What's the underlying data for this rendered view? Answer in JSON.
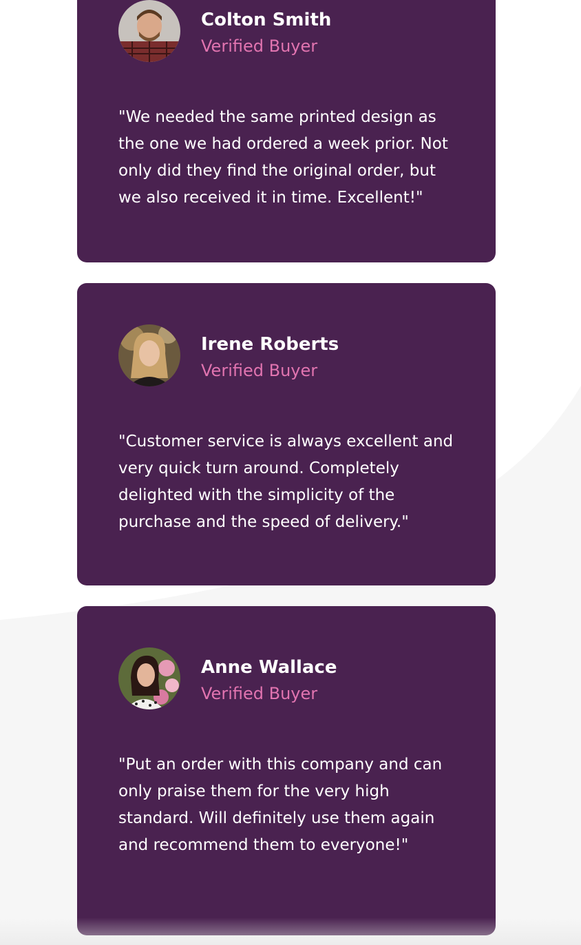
{
  "testimonials": [
    {
      "name": "Colton Smith",
      "role": "Verified Buyer",
      "quote": "\"We needed the same printed design as the one we had ordered a week prior. Not only did they find the original order, but we also received it in time. Excellent!\""
    },
    {
      "name": "Irene Roberts",
      "role": "Verified Buyer",
      "quote": "\"Customer service is always excellent and very quick turn around. Completely delighted with the simplicity of the purchase and the speed of delivery.\""
    },
    {
      "name": "Anne Wallace",
      "role": "Verified Buyer",
      "quote": "\"Put an order with this company and can only praise them for the very high standard. Will definitely use them again and recommend them to everyone!\""
    }
  ],
  "colors": {
    "card_background": "#4a2250",
    "name_text": "#ffffff",
    "role_text": "#e174b0",
    "quote_text": "#ffffff"
  }
}
